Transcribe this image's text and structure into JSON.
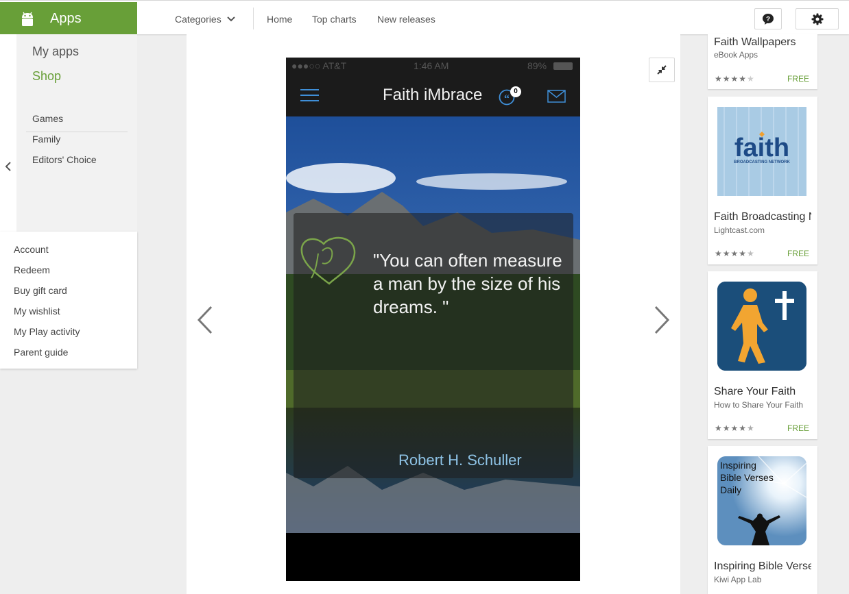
{
  "header": {
    "app_section": "Apps",
    "categories_label": "Categories",
    "nav": [
      "Home",
      "Top charts",
      "New releases"
    ],
    "help_icon": "help-icon",
    "settings_icon": "gear-icon",
    "brand_color": "#689f38"
  },
  "sidebar": {
    "my_apps": "My apps",
    "shop": "Shop",
    "categories": [
      "Games",
      "Family",
      "Editors' Choice"
    ],
    "account_links": [
      "Account",
      "Redeem",
      "Buy gift card",
      "My wishlist",
      "My Play activity",
      "Parent guide"
    ]
  },
  "screenshot": {
    "status_carrier": "●●●○○ AT&T",
    "status_time": "1:46 AM",
    "status_battery": "89%",
    "app_title": "Faith iMbrace",
    "badge_count": "0",
    "quote": "\"You can often measure a man by the size of his dreams. \"",
    "author": "Robert H. Schuller"
  },
  "related_apps": [
    {
      "title": "Faith Wallpapers",
      "developer": "eBook Apps",
      "price": "FREE",
      "rating": 4.0
    },
    {
      "title": "Faith Broadcasting Network",
      "developer": "Lightcast.com",
      "price": "FREE",
      "rating": 4.5,
      "icon_text": "faith",
      "icon_subtext": "BROADCASTING NETWORK"
    },
    {
      "title": "Share Your Faith",
      "developer": "How to Share Your Faith",
      "price": "FREE",
      "rating": 4.5
    },
    {
      "title": "Inspiring Bible Verses Daily",
      "developer": "Kiwi App Lab",
      "icon_text": "Inspiring Bible Verses Daily"
    }
  ]
}
